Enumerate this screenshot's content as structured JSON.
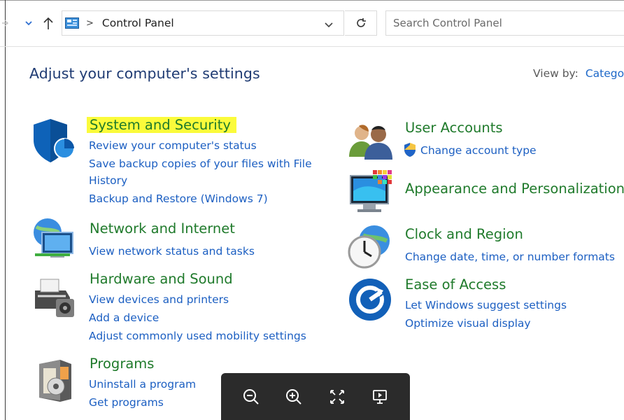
{
  "nav": {
    "breadcrumb": "Control Panel",
    "search_placeholder": "Search Control Panel"
  },
  "heading": "Adjust your computer's settings",
  "view_by": {
    "label": "View by:",
    "value": "Catego"
  },
  "categories": [
    {
      "title": "System and Security",
      "highlighted": true,
      "icon": "shield-icon",
      "links": [
        "Review your computer's status",
        "Save backup copies of your files with File",
        "History",
        "Backup and Restore (Windows 7)"
      ]
    },
    {
      "title": "Network and Internet",
      "icon": "network-icon",
      "links": [
        "View network status and tasks"
      ]
    },
    {
      "title": "Hardware and Sound",
      "icon": "printer-icon",
      "links": [
        "View devices and printers",
        "Add a device",
        "Adjust commonly used mobility settings"
      ]
    },
    {
      "title": "Programs",
      "icon": "programs-icon",
      "links": [
        "Uninstall a program",
        "Get programs"
      ]
    },
    {
      "title": "User Accounts",
      "icon": "users-icon",
      "links": [
        "Change account type"
      ]
    },
    {
      "title": "Appearance and Personalization",
      "icon": "appearance-icon",
      "links": []
    },
    {
      "title": "Clock and Region",
      "icon": "clock-icon",
      "links": [
        "Change date, time, or number formats"
      ]
    },
    {
      "title": "Ease of Access",
      "icon": "ease-of-access-icon",
      "links": [
        "Let Windows suggest settings",
        "Optimize visual display"
      ]
    }
  ],
  "toolbar": {
    "buttons": [
      "zoom-out-icon",
      "zoom-in-icon",
      "fit-screen-icon",
      "present-icon"
    ]
  },
  "colors": {
    "heading": "#1f3b73",
    "category_title": "#1f7a2b",
    "link": "#1c5fc2",
    "highlight": "#fbfb3b",
    "toolbar": "#2b2b2b"
  }
}
